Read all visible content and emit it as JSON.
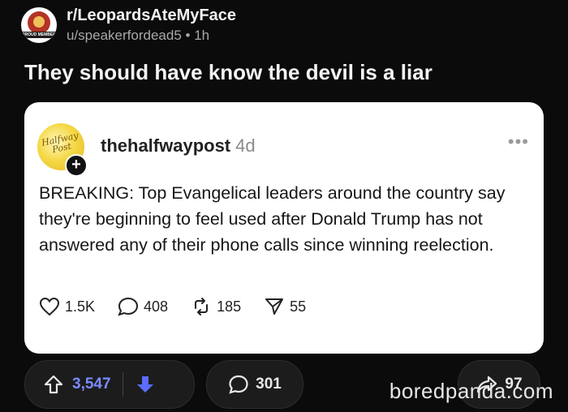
{
  "post": {
    "subreddit": "r/LeopardsAteMyFace",
    "author": "u/speakerfordead5",
    "separator": "•",
    "age": "1h",
    "avatar_badge": "PROUD MEMBER",
    "title": "They should have know the devil is a liar"
  },
  "embedded": {
    "avatar_text": "Halfway Post",
    "follow_symbol": "+",
    "handle": "thehalfwaypost",
    "age": "4d",
    "menu_symbol": "•••",
    "text": "BREAKING: Top Evangelical leaders around the country say they're beginning to feel used after Donald Trump has not answered any of their phone calls since winning reelection.",
    "stats": {
      "likes": "1.5K",
      "replies": "408",
      "reposts": "185",
      "shares": "55"
    }
  },
  "actions": {
    "upvotes": "3,547",
    "comments": "301",
    "shares": "97"
  },
  "watermark": "boredpanda.com",
  "colors": {
    "background": "#0b0b0b",
    "upvote_count": "#7a8bff",
    "downvote_icon": "#5b6cff",
    "card": "#ffffff"
  }
}
